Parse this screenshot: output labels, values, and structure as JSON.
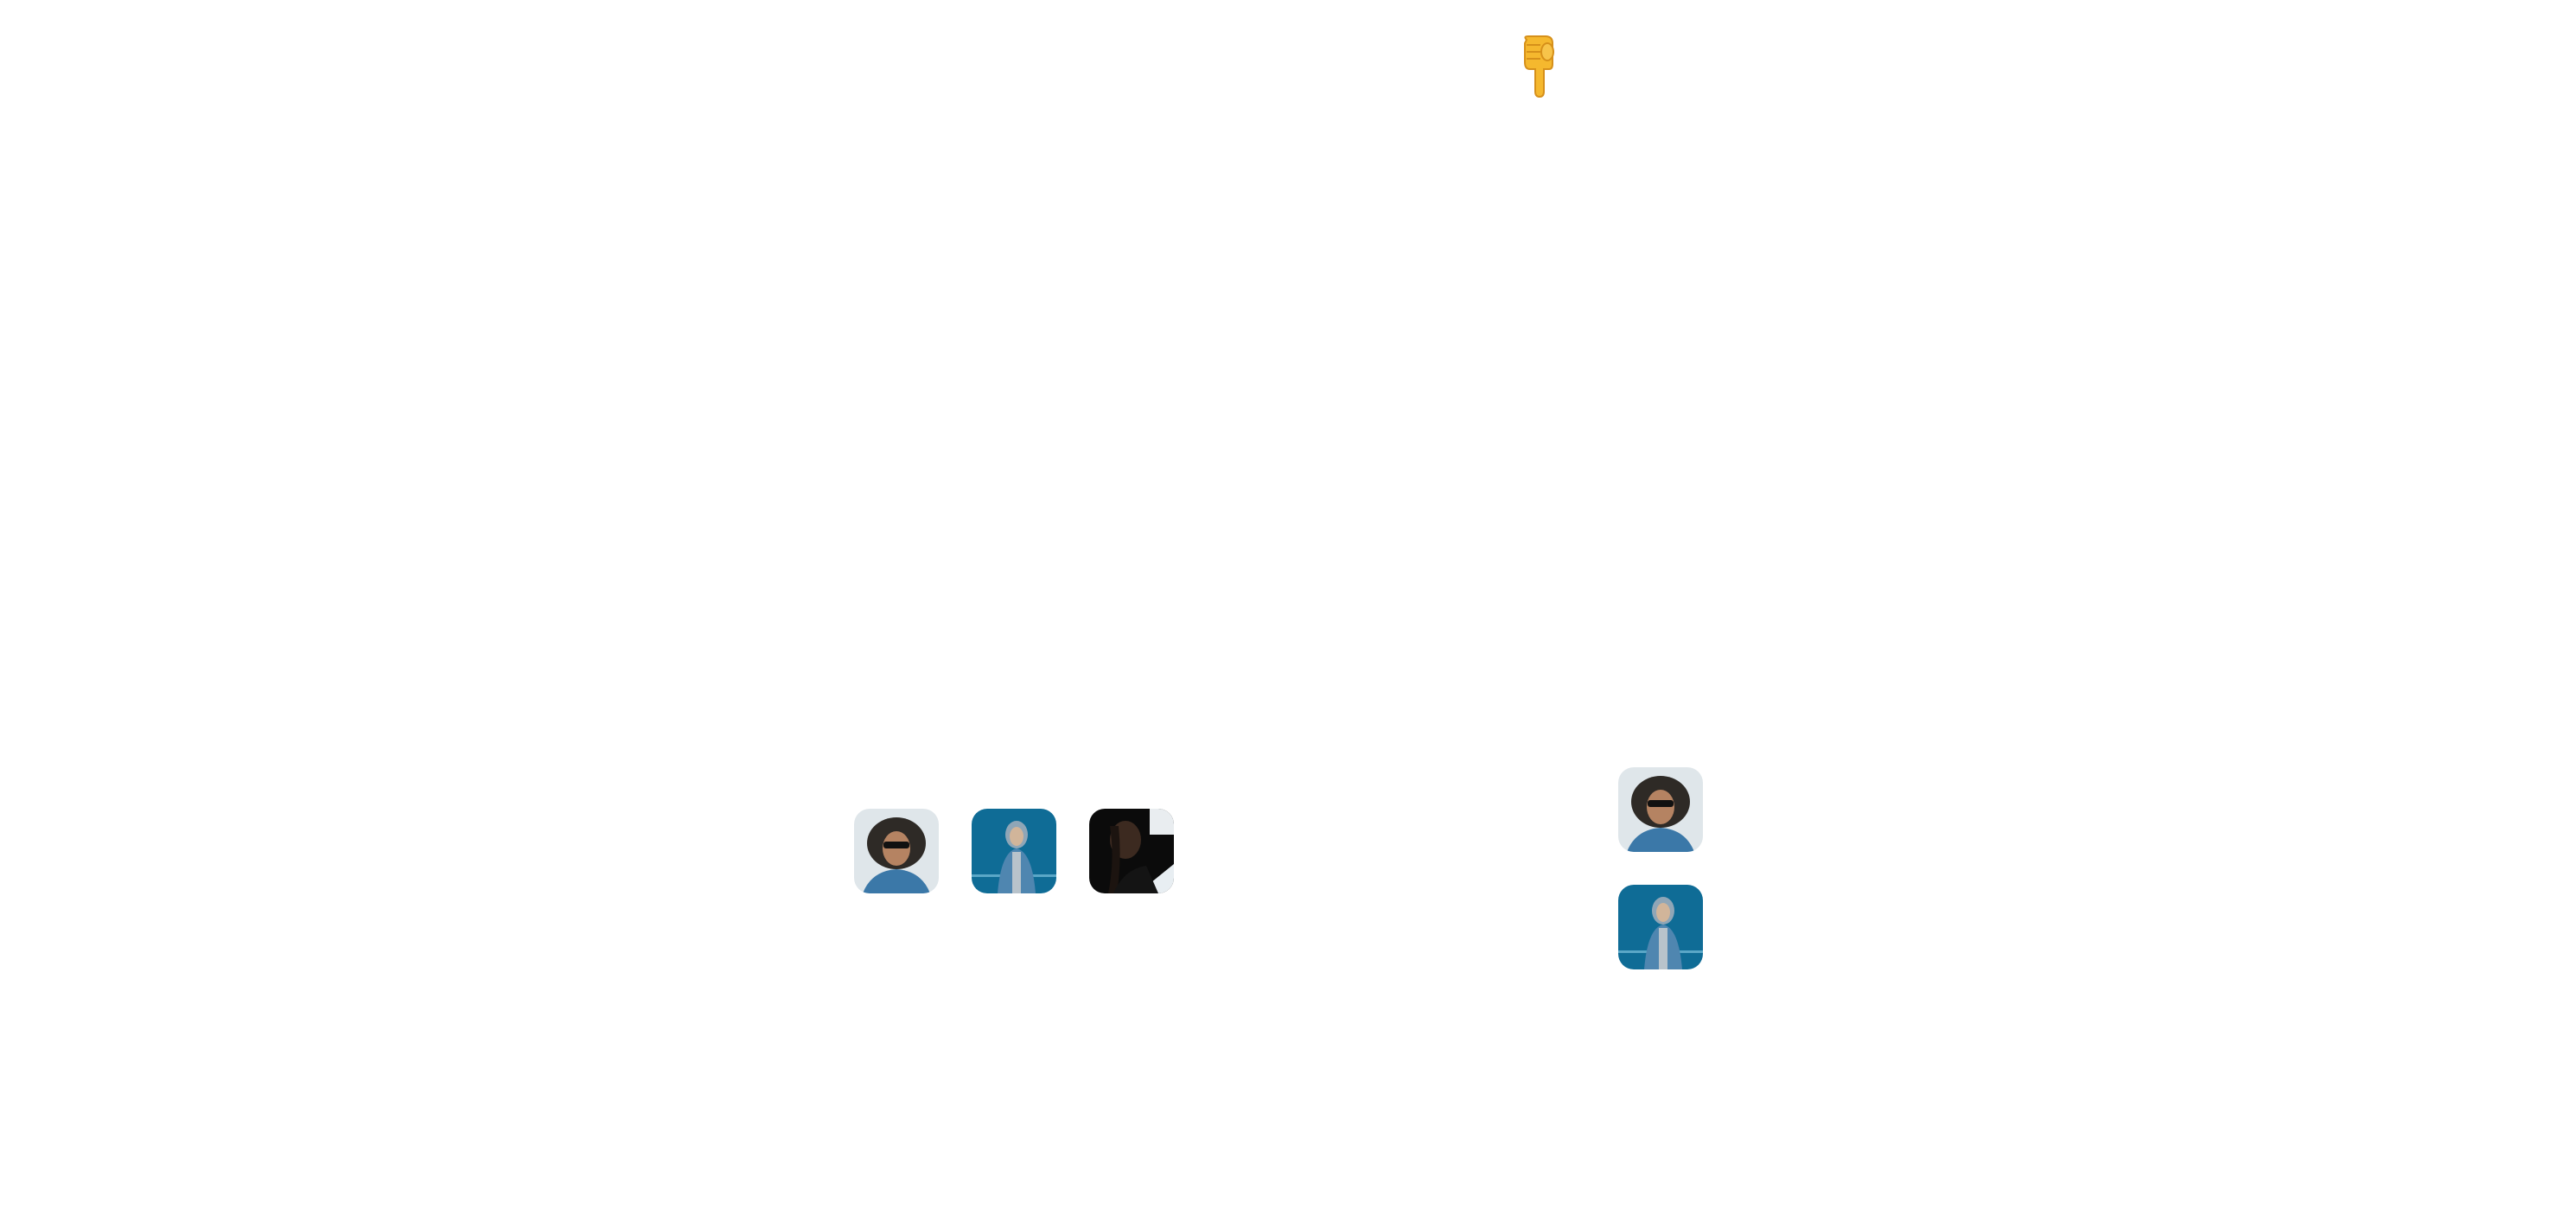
{
  "pointer": {
    "icon": "backhand-index-pointing-down-icon",
    "color": "#f2b52a"
  },
  "avatar_row": [
    {
      "icon": "avatar-curly-hair-sunglasses",
      "background": "#dfe6ea"
    },
    {
      "icon": "avatar-hooded-woman-blue-wall",
      "background": "#0f6c96"
    },
    {
      "icon": "avatar-braided-man-dark",
      "background": "#0b0b0b"
    }
  ],
  "avatar_column": [
    {
      "icon": "avatar-curly-hair-sunglasses",
      "background": "#dfe6ea"
    },
    {
      "icon": "avatar-hooded-woman-blue-wall",
      "background": "#0f6c96"
    }
  ]
}
